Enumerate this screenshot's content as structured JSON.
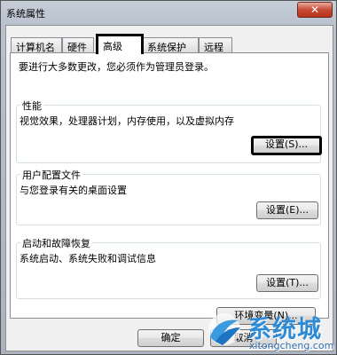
{
  "window": {
    "title": "系统属性",
    "close_glyph": "✕"
  },
  "tabs": [
    {
      "label": "计算机名"
    },
    {
      "label": "硬件"
    },
    {
      "label": "高级"
    },
    {
      "label": "系统保护"
    },
    {
      "label": "远程"
    }
  ],
  "active_tab": "高级",
  "admin_note": "要进行大多数更改，您必须作为管理员登录。",
  "performance": {
    "title": "性能",
    "desc": "视觉效果，处理器计划，内存使用，以及虚拟内存",
    "button": "设置(S)..."
  },
  "profiles": {
    "title": "用户配置文件",
    "desc": "与您登录有关的桌面设置",
    "button": "设置(E)..."
  },
  "startup": {
    "title": "启动和故障恢复",
    "desc": "系统启动、系统失败和调试信息",
    "button": "设置(T)..."
  },
  "env_button": "环境变量(N)...",
  "footer": {
    "ok": "确定",
    "cancel": "取消"
  },
  "watermark": {
    "name": "系统城",
    "url": "xitongcheng.com"
  },
  "colors": {
    "highlight_border": "#000000",
    "watermark_blue": "#2f8ad6"
  }
}
